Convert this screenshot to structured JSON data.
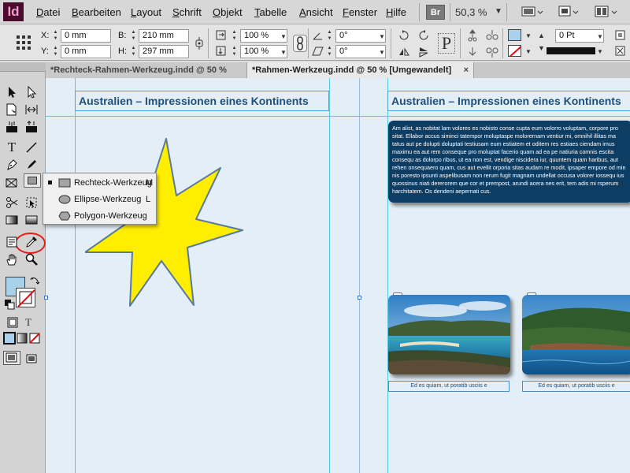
{
  "app": {
    "logo": "Id"
  },
  "menubar": {
    "items": [
      "Datei",
      "Bearbeiten",
      "Layout",
      "Schrift",
      "Objekt",
      "Tabelle",
      "Ansicht",
      "Fenster",
      "Hilfe"
    ],
    "bridge_label": "Br",
    "zoom": "50,3 %"
  },
  "controlbar": {
    "x_label": "X:",
    "x_value": "0 mm",
    "y_label": "Y:",
    "y_value": "0 mm",
    "w_label": "B:",
    "w_value": "210 mm",
    "h_label": "H:",
    "h_value": "297 mm",
    "scale_x": "100 %",
    "scale_y": "100 %",
    "rotate": "0°",
    "shear": "0°",
    "stroke_weight": "0 Pt",
    "text_frame_glyph": "P"
  },
  "tabs": [
    {
      "label": "*Rechteck-Rahmen-Werkzeug.indd @ 50 %",
      "close": "×",
      "active": false
    },
    {
      "label": "*Rahmen-Werkzeug.indd @ 50 % [Umgewandelt]",
      "close": "×",
      "active": true
    }
  ],
  "flyout": {
    "items": [
      {
        "label": "Rechteck-Werkzeug",
        "key": "M",
        "icon": "rectangle-icon",
        "selected": true
      },
      {
        "label": "Ellipse-Werkzeug",
        "key": "L",
        "icon": "ellipse-icon",
        "selected": false
      },
      {
        "label": "Polygon-Werkzeug",
        "key": "",
        "icon": "polygon-icon",
        "selected": false
      }
    ]
  },
  "document": {
    "heading_left": "Australien – Impressionen eines Kontinents",
    "heading_right": "Australien – Impressionen eines Kontinents",
    "body_text": "Am alist, as nobitat lam volores es nobisto conse cupta eum volorro voluptam, corpore pro sitat. Ellabor accus siminci tatempor moluptaspe molorernam ventiur mi, omnihil illitas ma tatus aut pe dolupti doluptati testiusam eum estiatem et oditem res estiaes ciendam imus maximu ea aut rem conseque pro moluptat facerio quam ad ea pe natiuria comnis escita consequ as dolorpo ribus, ut ea non est, vendige niscidera iur, quuntem quam haribus, aut rehen onsequaero quam, cus aut evellit orporia sitas audam re modit, ipsaper empore od min nis poresto ipsunti aspelibusam non rerum fugit magnam undellat occusa volorer iossequ ius quossinus niati dererorem que cor et prempost, arundi acera nes erit, tem adis mi rsperum harchitatem. Os dendeni aepernati cus.",
    "caption_1": "Ed es quiam, ut poratib usciis e",
    "caption_2": "Ed es quiam, ut poratib usciis e"
  },
  "colors": {
    "star_fill": "#ffee00",
    "star_stroke": "#5a7a9a",
    "heading_text": "#1f4f7b",
    "text_box": "#0e3d63",
    "guide": "#53c9e4",
    "highlight_ring": "#e21d1d",
    "fill_swatch": "#a9d1ea"
  }
}
